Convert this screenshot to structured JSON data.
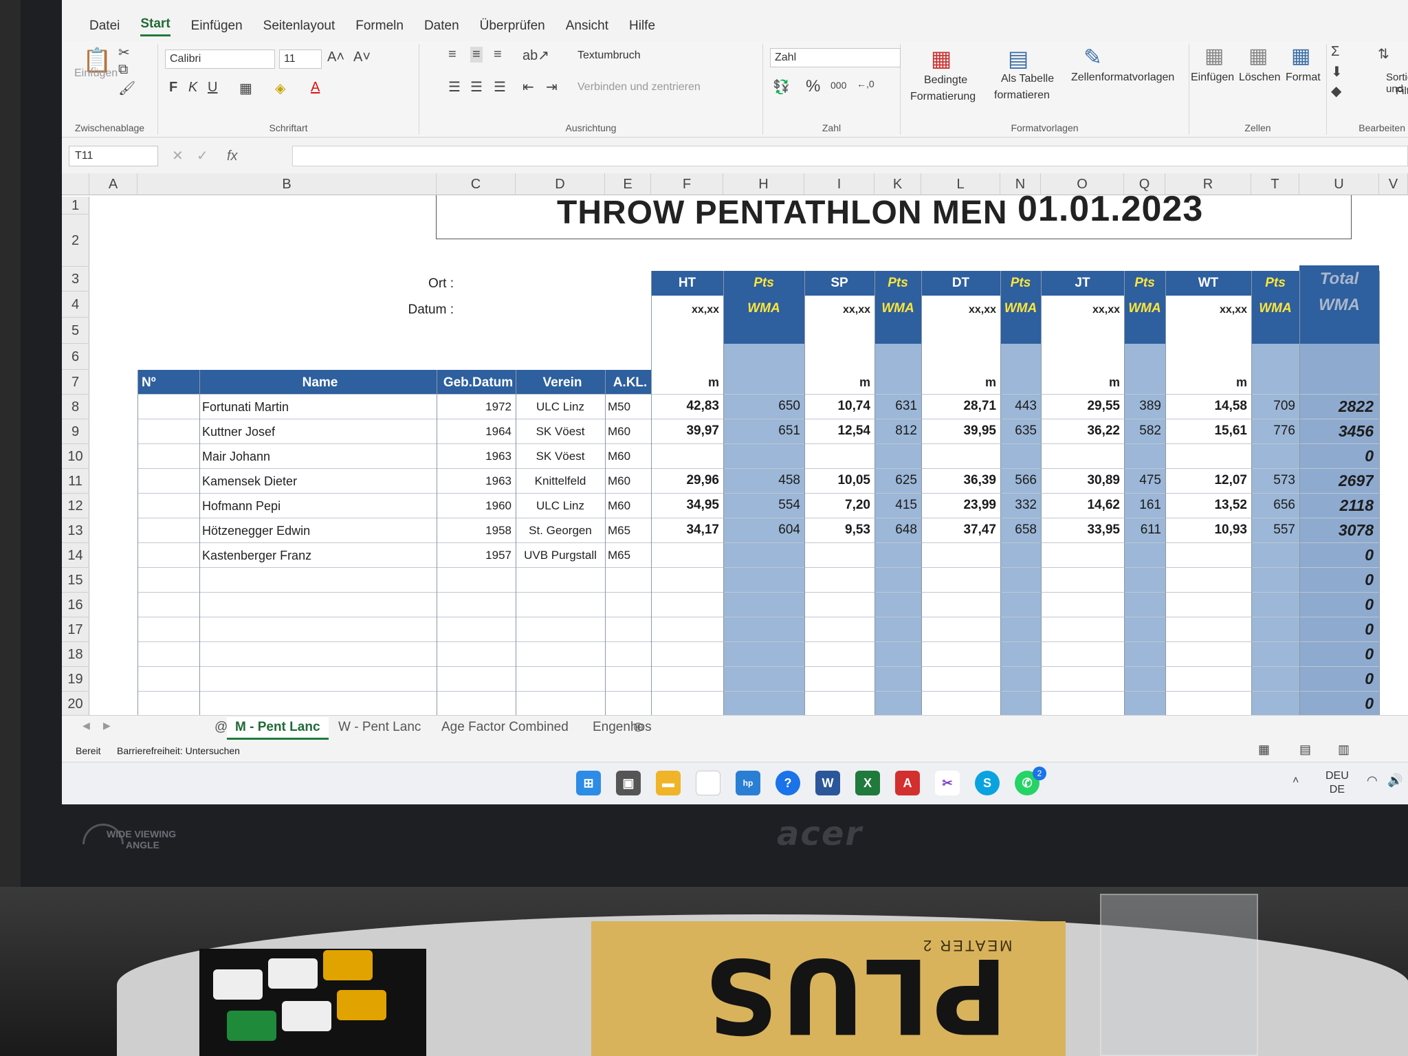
{
  "ribbon": {
    "tabs": [
      "Datei",
      "Start",
      "Einfügen",
      "Seitenlayout",
      "Formeln",
      "Daten",
      "Überprüfen",
      "Ansicht",
      "Hilfe"
    ],
    "active_tab": "Start",
    "clipboard": {
      "paste": "Einfügen",
      "group": "Zwischenablage"
    },
    "font": {
      "name": "Calibri",
      "size": "11",
      "bold": "F",
      "italic": "K",
      "underline": "U",
      "group": "Schriftart"
    },
    "alignment": {
      "wrap": "Textumbruch",
      "merge": "Verbinden und zentrieren",
      "group": "Ausrichtung"
    },
    "number": {
      "format": "Zahl",
      "percent": "%",
      "thousands": "000",
      "group": "Zahl"
    },
    "styles": {
      "conditional_1": "Bedingte",
      "conditional_2": "Formatierung",
      "table_1": "Als Tabelle",
      "table_2": "formatieren",
      "cell_styles": "Zellenformatvorlagen",
      "group": "Formatvorlagen"
    },
    "cells": {
      "insert": "Einfügen",
      "delete": "Löschen",
      "format": "Format",
      "group": "Zellen"
    },
    "editing": {
      "sort_1": "Sortieren und",
      "sort_2": "Filtern",
      "group": "Bearbeiten",
      "autosum": "Σ",
      "find_cut": "S",
      "find_sub": "Au"
    }
  },
  "formula_bar": {
    "name_box": "T11",
    "fx": "fx"
  },
  "columns": [
    "A",
    "B",
    "C",
    "D",
    "E",
    "F",
    "H",
    "I",
    "K",
    "L",
    "N",
    "O",
    "Q",
    "R",
    "T",
    "U",
    "V"
  ],
  "rows": [
    "1",
    "2",
    "3",
    "4",
    "5",
    "6",
    "7",
    "8",
    "9",
    "10",
    "11",
    "12",
    "13",
    "14",
    "15",
    "16",
    "17",
    "18",
    "19",
    "20"
  ],
  "sheet": {
    "title": "THROW PENTATHLON MEN",
    "date": "01.01.2023",
    "ort_label": "Ort :",
    "datum_label": "Datum :",
    "header": {
      "nr": "Nº",
      "name": "Name",
      "geb": "Geb.Datum",
      "verein": "Verein",
      "akl": "A.KL."
    },
    "events": [
      {
        "code": "HT",
        "pts": "Pts",
        "wma": "WMA",
        "unit_hint": "xx,xx",
        "unit": "m"
      },
      {
        "code": "SP",
        "pts": "Pts",
        "wma": "WMA",
        "unit_hint": "xx,xx",
        "unit": "m"
      },
      {
        "code": "DT",
        "pts": "Pts",
        "wma": "WMA",
        "unit_hint": "xx,xx",
        "unit": "m"
      },
      {
        "code": "JT",
        "pts": "Pts",
        "wma": "WMA",
        "unit_hint": "xx,xx",
        "unit": "m"
      },
      {
        "code": "WT",
        "pts": "Pts",
        "wma": "WMA",
        "unit_hint": "xx,xx",
        "unit": "m"
      }
    ],
    "total": {
      "line1": "Total",
      "line2": "WMA"
    },
    "athletes": [
      {
        "name": "Fortunati Martin",
        "geb": "1972",
        "verein": "ULC Linz",
        "akl": "M50",
        "res": [
          "42,83",
          "650",
          "10,74",
          "631",
          "28,71",
          "443",
          "29,55",
          "389",
          "14,58",
          "709"
        ],
        "total": "2822"
      },
      {
        "name": "Kuttner Josef",
        "geb": "1964",
        "verein": "SK Vöest",
        "akl": "M60",
        "res": [
          "39,97",
          "651",
          "12,54",
          "812",
          "39,95",
          "635",
          "36,22",
          "582",
          "15,61",
          "776"
        ],
        "total": "3456"
      },
      {
        "name": "Mair Johann",
        "geb": "1963",
        "verein": "SK Vöest",
        "akl": "M60",
        "res": [
          "",
          "",
          "",
          "",
          "",
          "",
          "",
          "",
          "",
          ""
        ],
        "total": "0"
      },
      {
        "name": "Kamensek Dieter",
        "geb": "1963",
        "verein": "Knittelfeld",
        "akl": "M60",
        "res": [
          "29,96",
          "458",
          "10,05",
          "625",
          "36,39",
          "566",
          "30,89",
          "475",
          "12,07",
          "573"
        ],
        "total": "2697"
      },
      {
        "name": "Hofmann Pepi",
        "geb": "1960",
        "verein": "ULC Linz",
        "akl": "M60",
        "res": [
          "34,95",
          "554",
          "7,20",
          "415",
          "23,99",
          "332",
          "14,62",
          "161",
          "13,52",
          "656"
        ],
        "total": "2118"
      },
      {
        "name": "Hötzenegger Edwin",
        "geb": "1958",
        "verein": "St. Georgen",
        "akl": "M65",
        "res": [
          "34,17",
          "604",
          "9,53",
          "648",
          "37,47",
          "658",
          "33,95",
          "611",
          "10,93",
          "557"
        ],
        "total": "3078"
      },
      {
        "name": "Kastenberger Franz",
        "geb": "1957",
        "verein": "UVB Purgstall",
        "akl": "M65",
        "res": [
          "",
          "",
          "",
          "",
          "",
          "",
          "",
          "",
          "",
          ""
        ],
        "total": "0"
      }
    ],
    "empty_totals": [
      "0",
      "0",
      "0",
      "0",
      "0",
      "0"
    ]
  },
  "sheet_tabs": [
    "@",
    "M - Pent Lanc",
    "W - Pent Lanc",
    "Age Factor Combined",
    "Engenhos"
  ],
  "active_sheet": "M - Pent Lanc",
  "status": {
    "ready": "Bereit",
    "accessibility": "Barrierefreiheit: Untersuchen"
  },
  "tray": {
    "lang1": "DEU",
    "lang2": "DE",
    "whatsapp_badge": "2"
  },
  "monitor": {
    "brand": "acer",
    "wide1": "WIDE VIEWING",
    "wide2": "ANGLE"
  },
  "desk": {
    "box_brand": "PLUS",
    "box_sub": "MEATER 2"
  }
}
